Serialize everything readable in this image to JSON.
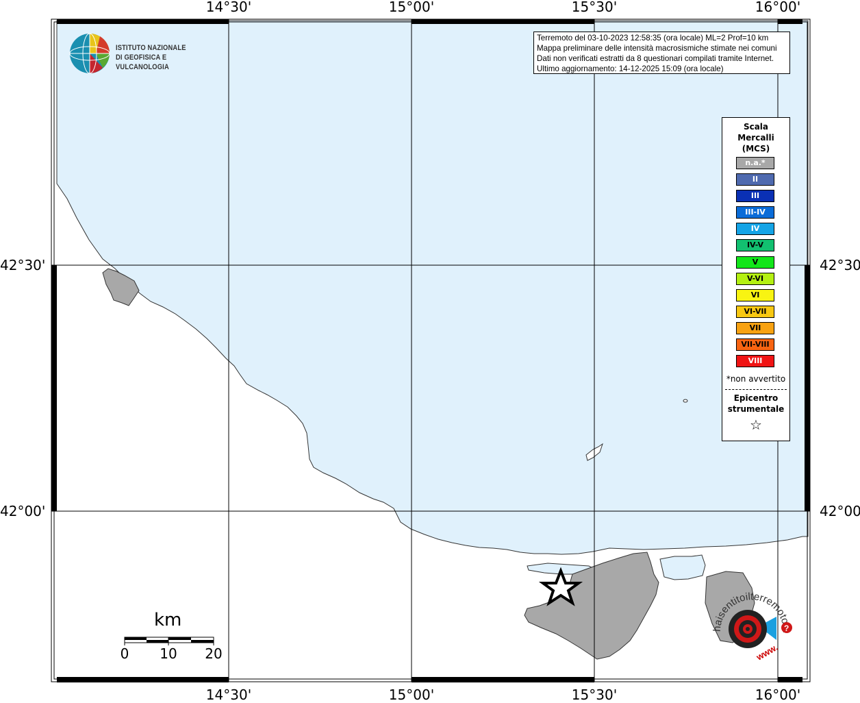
{
  "map": {
    "colors": {
      "sea": "#e0f1fc",
      "land": "#ffffff",
      "affected_area": "#a8a8a8",
      "frame": "#000000",
      "grid": "#000000"
    },
    "lon_labels": [
      "14°30'",
      "15°00'",
      "15°30'",
      "16°00'"
    ],
    "lat_labels": [
      "42°30'",
      "42°00'"
    ],
    "epicenter_marker": "star-icon"
  },
  "logo": {
    "line1": "ISTITUTO NAZIONALE",
    "line2": "DI GEOFISICA E VULCANOLOGIA",
    "icon": "ingv-globe-icon"
  },
  "info": {
    "line1": "Terremoto del 03-10-2023 12:58:35 (ora locale) ML=2 Prof=10 km",
    "line2": "Mappa preliminare delle intensità macrosismiche stimate nei comuni",
    "line3": "Dati non verificati estratti da 8 questionari compilati tramite Internet.",
    "line4": "Ultimo aggiornamento: 14-12-2025 15:09 (ora locale)"
  },
  "legend": {
    "title1": "Scala",
    "title2": "Mercalli",
    "title3": "(MCS)",
    "items": [
      {
        "label": "n.a.*",
        "color": "#a8a8a8",
        "text_color": "#ffffff"
      },
      {
        "label": "II",
        "color": "#4f6aaf",
        "text_color": "#ffffff"
      },
      {
        "label": "III",
        "color": "#0a30b4",
        "text_color": "#ffffff"
      },
      {
        "label": "III-IV",
        "color": "#0a6cd8",
        "text_color": "#ffffff"
      },
      {
        "label": "IV",
        "color": "#14a4e6",
        "text_color": "#ffffff"
      },
      {
        "label": "IV-V",
        "color": "#12c070",
        "text_color": "#000000"
      },
      {
        "label": "V",
        "color": "#12e61a",
        "text_color": "#000000"
      },
      {
        "label": "V-VI",
        "color": "#b4f012",
        "text_color": "#000000"
      },
      {
        "label": "VI",
        "color": "#f8f412",
        "text_color": "#000000"
      },
      {
        "label": "VI-VII",
        "color": "#f8c812",
        "text_color": "#000000"
      },
      {
        "label": "VII",
        "color": "#f8a212",
        "text_color": "#000000"
      },
      {
        "label": "VII-VIII",
        "color": "#f86412",
        "text_color": "#000000"
      },
      {
        "label": "VIII",
        "color": "#f01414",
        "text_color": "#ffffff"
      }
    ],
    "note": "*non avvertito",
    "epicenter_line1": "Epicentro",
    "epicenter_line2": "strumentale",
    "star_symbol": "☆"
  },
  "scalebar": {
    "unit": "km",
    "ticks": [
      "0",
      "10",
      "20"
    ]
  },
  "hst_logo": {
    "text": "haisentitoilterremoto.it",
    "url_text": "www.",
    "question": "?"
  }
}
